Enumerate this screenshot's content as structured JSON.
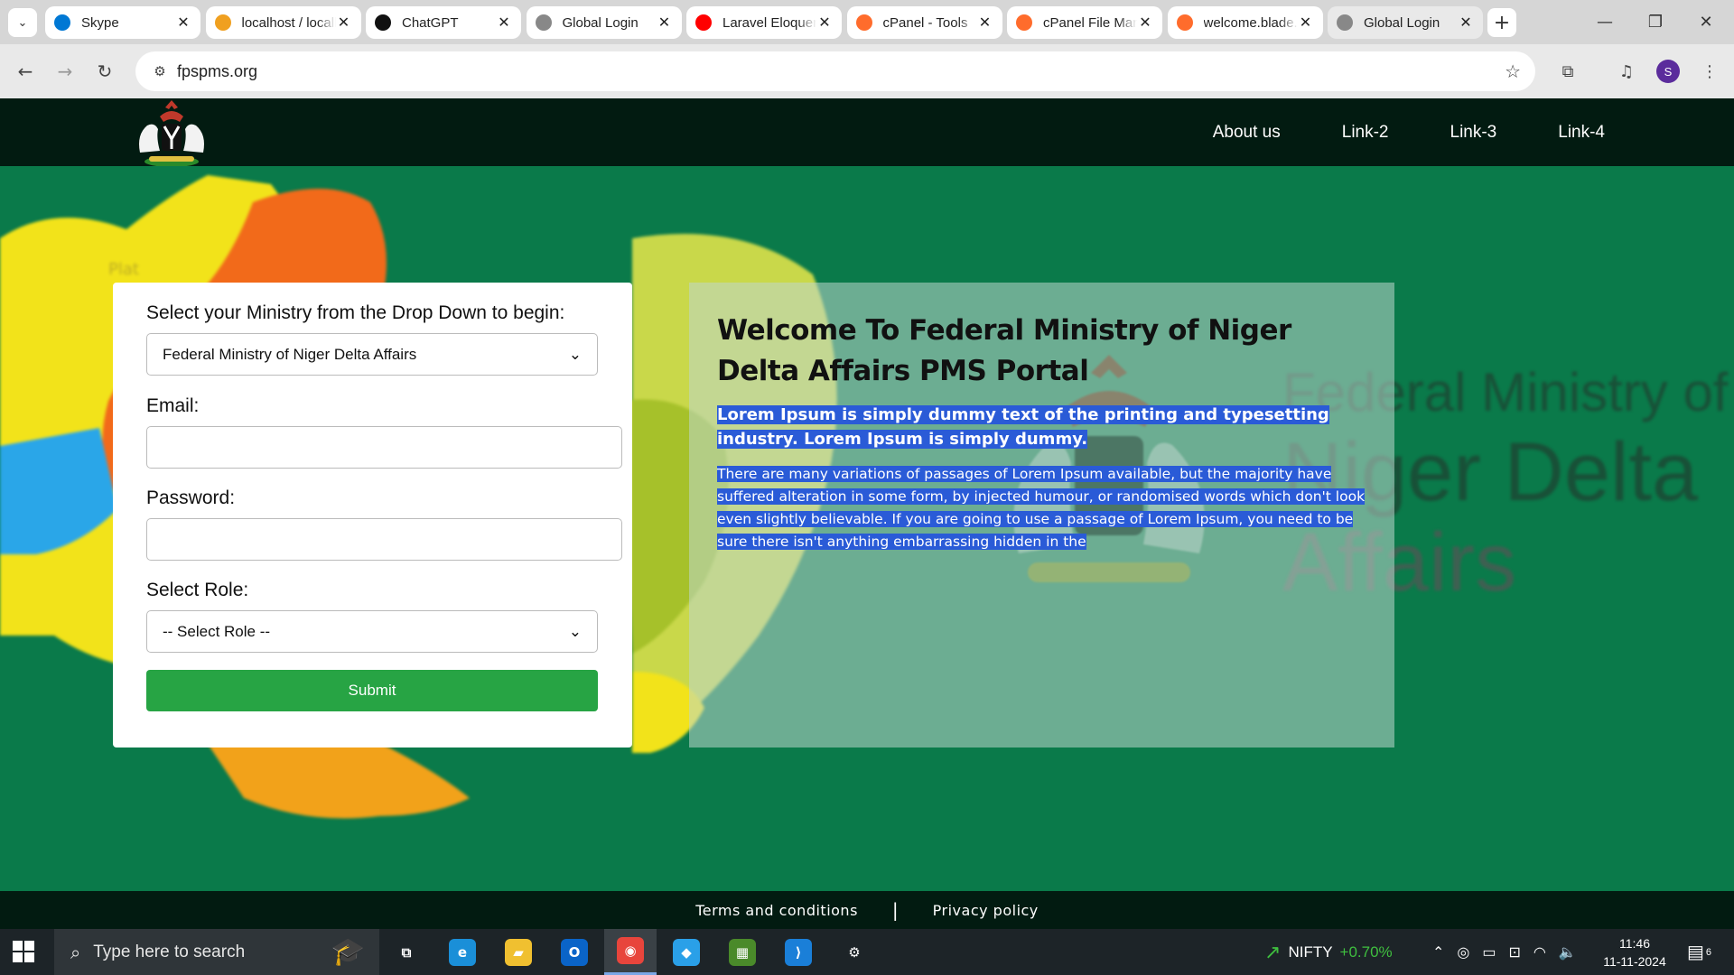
{
  "browser": {
    "tabs": [
      {
        "title": "Skype",
        "favicon": "skype-icon",
        "color": "#0078d4",
        "active": false
      },
      {
        "title": "localhost / localhost",
        "favicon": "phpmyadmin-icon",
        "color": "#f0a020",
        "active": false
      },
      {
        "title": "ChatGPT",
        "favicon": "chatgpt-icon",
        "color": "#111111",
        "active": false
      },
      {
        "title": "Global Login",
        "favicon": "globe-icon",
        "color": "#888888",
        "active": false
      },
      {
        "title": "Laravel Eloquent",
        "favicon": "youtube-icon",
        "color": "#ff0000",
        "active": false
      },
      {
        "title": "cPanel - Tools",
        "favicon": "cpanel-icon",
        "color": "#ff6c2c",
        "active": false
      },
      {
        "title": "cPanel File Manager",
        "favicon": "cpanel-icon",
        "color": "#ff6c2c",
        "active": false
      },
      {
        "title": "welcome.blade.php",
        "favicon": "cpanel-icon",
        "color": "#ff6c2c",
        "active": false
      },
      {
        "title": "Global Login",
        "favicon": "globe-icon",
        "color": "#888888",
        "active": true
      }
    ],
    "url": "fpspms.org",
    "profile_initial": "S"
  },
  "site": {
    "nav": [
      "About us",
      "Link-2",
      "Link-3",
      "Link-4"
    ],
    "login": {
      "ministry_label": "Select your Ministry from the Drop Down to begin:",
      "ministry_selected": "Federal Ministry of Niger Delta Affairs",
      "email_label": "Email:",
      "email_value": "",
      "password_label": "Password:",
      "password_value": "",
      "role_label": "Select Role:",
      "role_selected": "-- Select Role --",
      "submit_label": "Submit"
    },
    "welcome": {
      "title": "Welcome To Federal Ministry of Niger Delta Affairs PMS Portal",
      "lead": "Lorem Ipsum is simply dummy text of the printing and typesetting industry. Lorem Ipsum is simply dummy.",
      "body": "There are many variations of passages of Lorem Ipsum available, but the majority have suffered alteration in some form, by injected humour, or randomised words which don't look even slightly believable. If you are going to use a passage of Lorem Ipsum, you need to be sure there isn't anything embarrassing hidden in the"
    },
    "background_text": [
      "Federal Ministry of",
      "Niger Delta",
      "Affairs"
    ],
    "footer": {
      "terms": "Terms and conditions",
      "separator": "|",
      "privacy": "Privacy policy"
    },
    "colors": {
      "header": "#021b11",
      "hero": "#0a7a4a",
      "submit": "#27a444",
      "selection": "#2a5bd7"
    }
  },
  "taskbar": {
    "search_placeholder": "Type here to search",
    "apps": [
      "task-view-icon",
      "edge-icon",
      "file-explorer-icon",
      "outlook-icon",
      "chrome-icon",
      "app-icon",
      "sheets-icon",
      "vscode-icon",
      "settings-icon"
    ],
    "stock_name": "NIFTY",
    "stock_change": "+0.70%",
    "time": "11:46",
    "date": "11-11-2024",
    "notification_count": "6"
  }
}
